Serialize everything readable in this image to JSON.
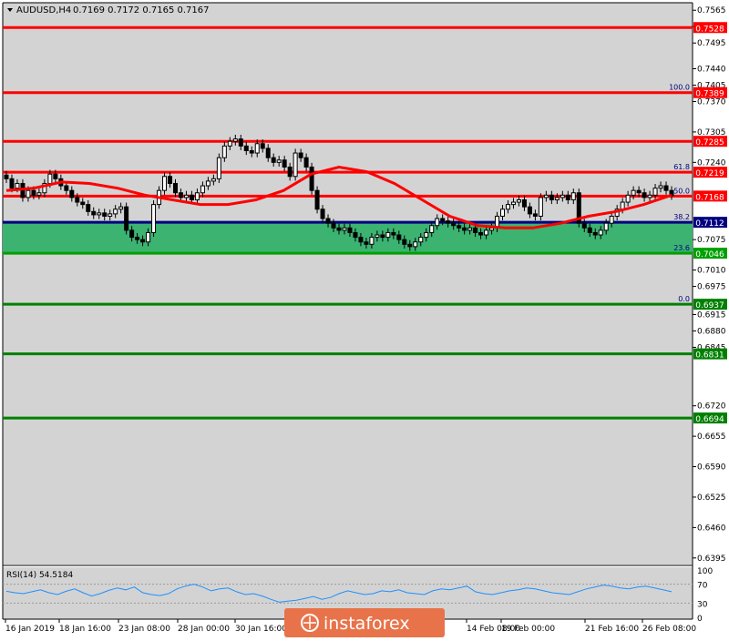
{
  "header": {
    "symbol_label": "AUDUSD,H4",
    "ohlc": "0.7169 0.7172 0.7165 0.7167"
  },
  "rsi_header": "RSI(14) 54.5184",
  "watermark": "instaforex",
  "chart_data": {
    "type": "candlestick",
    "symbol": "AUDUSD",
    "timeframe": "H4",
    "ylim": [
      0.6381,
      0.7581
    ],
    "yticks": [
      "0.7565",
      "0.7530",
      "0.7495",
      "0.7440",
      "0.7405",
      "0.7370",
      "0.7305",
      "0.7240",
      "0.7075",
      "0.7010",
      "0.6975",
      "0.6915",
      "0.6880",
      "0.6845",
      "0.6720",
      "0.6655",
      "0.6590",
      "0.6525",
      "0.6460",
      "0.6395"
    ],
    "xticks": [
      "16 Jan 2019",
      "18 Jan 16:00",
      "23 Jan 08:00",
      "28 Jan 00:00",
      "30 Jan 16:00",
      "14 Feb 08:00",
      "19 Feb 00:00",
      "21 Feb 16:00",
      "26 Feb 08:00"
    ],
    "levels": [
      {
        "price": 0.7528,
        "label": "0.7528",
        "color": "#ff0000",
        "fib": ""
      },
      {
        "price": 0.7389,
        "label": "0.7389",
        "color": "#ff0000",
        "fib": "100.0"
      },
      {
        "price": 0.7285,
        "label": "0.7285",
        "color": "#ff0000",
        "fib": ""
      },
      {
        "price": 0.7219,
        "label": "0.7219",
        "color": "#ff0000",
        "fib": "61.8"
      },
      {
        "price": 0.7168,
        "label": "0.7168",
        "color": "#ff0000",
        "fib": "50.0"
      },
      {
        "price": 0.7112,
        "label": "0.7112",
        "color": "#000080",
        "fib": "38.2"
      },
      {
        "price": 0.7046,
        "label": "0.7046",
        "color": "#00a000",
        "fib": "23.6"
      },
      {
        "price": 0.6937,
        "label": "0.6937",
        "color": "#008000",
        "fib": "0.0"
      },
      {
        "price": 0.6831,
        "label": "0.6831",
        "color": "#008000",
        "fib": ""
      },
      {
        "price": 0.6694,
        "label": "0.6694",
        "color": "#008000",
        "fib": ""
      }
    ],
    "zone": {
      "from": 0.7046,
      "to": 0.7112,
      "color": "#3cb371"
    },
    "closes": [
      0.7205,
      0.7185,
      0.7195,
      0.7165,
      0.718,
      0.717,
      0.7175,
      0.7195,
      0.7215,
      0.7205,
      0.719,
      0.718,
      0.7165,
      0.7155,
      0.715,
      0.7135,
      0.7128,
      0.7132,
      0.7125,
      0.713,
      0.714,
      0.7145,
      0.7095,
      0.708,
      0.7075,
      0.707,
      0.709,
      0.715,
      0.718,
      0.721,
      0.7195,
      0.7175,
      0.7165,
      0.717,
      0.716,
      0.7175,
      0.719,
      0.72,
      0.7205,
      0.725,
      0.7275,
      0.7285,
      0.729,
      0.7275,
      0.7265,
      0.726,
      0.728,
      0.727,
      0.725,
      0.724,
      0.7245,
      0.723,
      0.721,
      0.726,
      0.725,
      0.723,
      0.718,
      0.714,
      0.712,
      0.711,
      0.71,
      0.7095,
      0.71,
      0.709,
      0.708,
      0.707,
      0.7065,
      0.708,
      0.7085,
      0.708,
      0.709,
      0.7085,
      0.7075,
      0.7065,
      0.706,
      0.707,
      0.708,
      0.709,
      0.7105,
      0.712,
      0.7115,
      0.711,
      0.7105,
      0.71,
      0.7095,
      0.71,
      0.709,
      0.7085,
      0.7095,
      0.71,
      0.7125,
      0.714,
      0.715,
      0.7155,
      0.716,
      0.7145,
      0.713,
      0.7125,
      0.7165,
      0.717,
      0.716,
      0.7165,
      0.717,
      0.716,
      0.7175,
      0.711,
      0.71,
      0.709,
      0.7085,
      0.7095,
      0.711,
      0.7125,
      0.714,
      0.7155,
      0.717,
      0.718,
      0.7175,
      0.7165,
      0.717,
      0.7185,
      0.719,
      0.718,
      0.7169
    ],
    "ma_points": [
      0.718,
      0.7185,
      0.7198,
      0.7195,
      0.7185,
      0.717,
      0.716,
      0.715,
      0.715,
      0.716,
      0.718,
      0.7215,
      0.723,
      0.722,
      0.7195,
      0.716,
      0.7125,
      0.7105,
      0.71,
      0.71,
      0.711,
      0.7125,
      0.7135,
      0.715,
      0.717
    ],
    "rsi": {
      "period": 14,
      "value": 54.5184,
      "ticks": [
        "100",
        "70",
        "30",
        "0"
      ],
      "levels": [
        70,
        30
      ],
      "values": [
        55,
        52,
        50,
        54,
        58,
        52,
        48,
        55,
        60,
        52,
        45,
        50,
        57,
        62,
        58,
        64,
        52,
        48,
        46,
        50,
        60,
        66,
        70,
        64,
        56,
        60,
        62,
        54,
        48,
        50,
        45,
        38,
        32,
        34,
        36,
        40,
        44,
        38,
        42,
        50,
        56,
        52,
        48,
        50,
        56,
        54,
        58,
        52,
        50,
        48,
        56,
        60,
        58,
        62,
        66,
        54,
        50,
        48,
        52,
        56,
        58,
        62,
        60,
        56,
        52,
        50,
        48,
        54,
        60,
        64,
        68,
        66,
        62,
        60,
        64,
        66,
        62,
        58,
        54
      ]
    }
  }
}
